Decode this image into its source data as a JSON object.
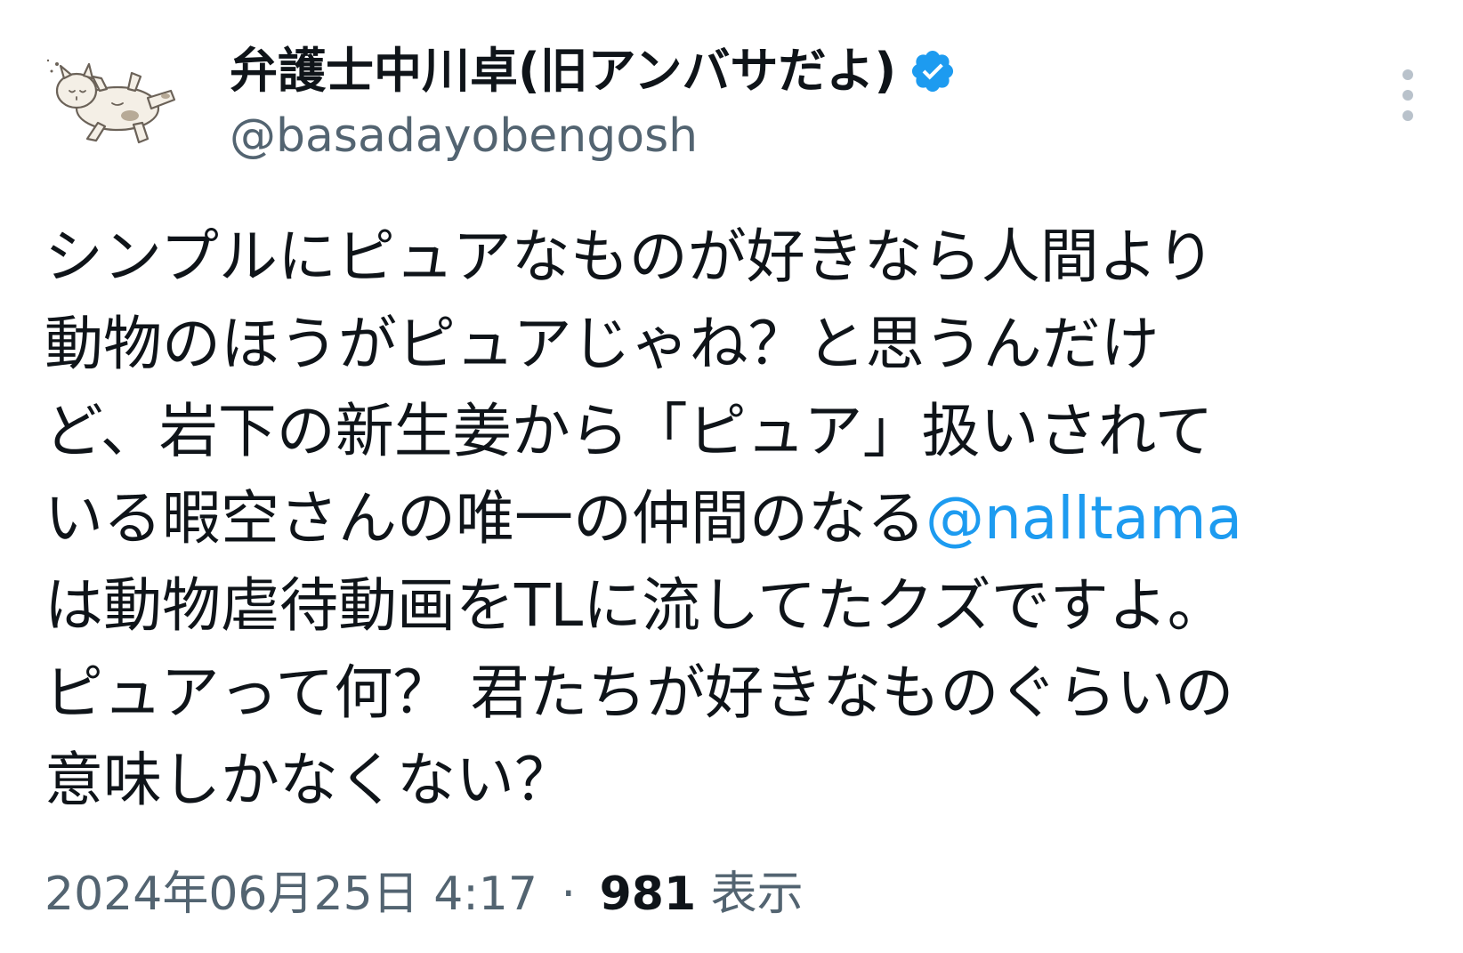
{
  "author": {
    "display_name": "弁護士中川卓(旧アンバサだよ)",
    "handle": "@basadayobengosh",
    "verified": true,
    "avatar_icon": "sleeping-cat-avatar"
  },
  "tweet": {
    "line1": "シンプルにピュアなものが好きなら人間より",
    "line2": "動物のほうがピュアじゃね？と思うんだけ",
    "line3": "ど、岩下の新生姜から「ピュア」扱いされて",
    "line4_before": "いる暇空さんの唯一の仲間のなる",
    "mention": "@nalltama",
    "line5": "は動物虐待動画をTLに流してたクズですよ。",
    "line6": "ピュアって何？ 君たちが好きなものぐらいの",
    "line7": "意味しかなくない？"
  },
  "meta": {
    "timestamp": "2024年06月25日 4:17",
    "separator": "·",
    "views_count": "981",
    "views_label": "表示"
  },
  "colors": {
    "text": "#0f1419",
    "secondary": "#536471",
    "link": "#1d9bf0",
    "verified_badge": "#1d9bf0",
    "more_icon": "#b9c2cb"
  }
}
